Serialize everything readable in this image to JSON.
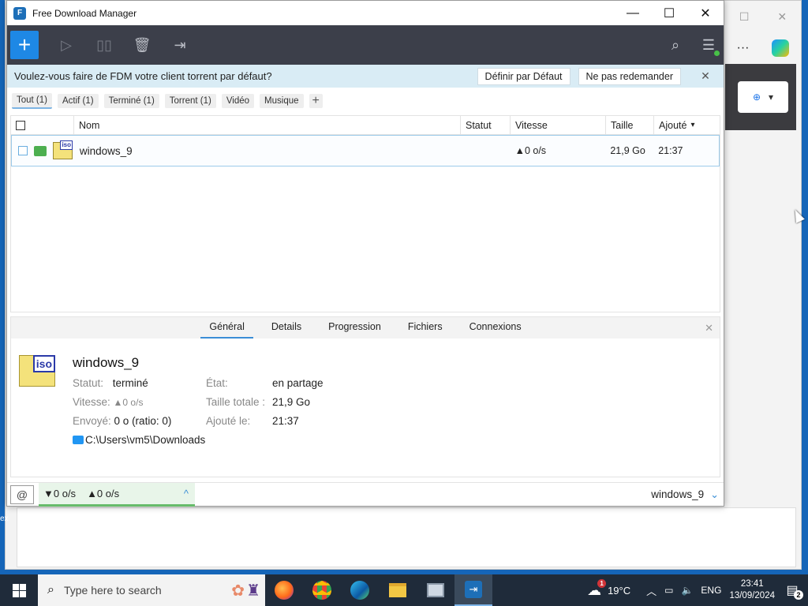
{
  "app": {
    "title": "Free Download Manager",
    "icon_glyph": "F"
  },
  "window_controls": {
    "minimize": "—",
    "maximize": "☐",
    "close": "✕"
  },
  "toolbar": {
    "add": "+",
    "icons": [
      "play-icon",
      "pause-icon",
      "delete-icon",
      "move-icon",
      "search-icon",
      "menu-icon"
    ],
    "accent": "#1e88e5"
  },
  "banner": {
    "text": "Voulez-vous faire de FDM votre client torrent par défaut?",
    "default_label": "Définir par Défaut",
    "dont_ask_label": "Ne pas redemander",
    "close": "✕"
  },
  "filters": [
    {
      "label": "Tout (1)",
      "active": true
    },
    {
      "label": "Actif (1)",
      "active": false
    },
    {
      "label": "Terminé (1)",
      "active": false
    },
    {
      "label": "Torrent (1)",
      "active": false
    },
    {
      "label": "Vidéo",
      "active": false
    },
    {
      "label": "Musique",
      "active": false
    }
  ],
  "filter_add": "+",
  "columns": {
    "name": "Nom",
    "status": "Statut",
    "speed": "Vitesse",
    "size": "Taille",
    "added": "Ajouté"
  },
  "downloads": [
    {
      "name": "windows_9",
      "status": "",
      "speed": "▲0 o/s",
      "size": "21,9 Go",
      "added": "21:37",
      "badge": "iso"
    }
  ],
  "details": {
    "tabs": [
      "Général",
      "Details",
      "Progression",
      "Fichiers",
      "Connexions"
    ],
    "active_tab": "Général",
    "close": "✕",
    "badge": "iso",
    "file_name": "windows_9",
    "status_label": "Statut:",
    "status_value": "terminé",
    "speed_label": "Vitesse:",
    "speed_value": "▲0 o/s",
    "sent_label": "Envoyé:",
    "sent_value": "0 o (ratio: 0)",
    "state_label": "État:",
    "state_value": "en partage",
    "total_size_label": "Taille totale :",
    "total_size_value": "21,9 Go",
    "added_label": "Ajouté le:",
    "added_value": "21:37",
    "path": "C:\\Users\\vm5\\Downloads"
  },
  "statusbar": {
    "download_speed": "▼0 o/s",
    "upload_speed": "▲0 o/s",
    "expand": "^",
    "current_file": "windows_9",
    "chevron": "⌄"
  },
  "background_browser": {
    "more": "···",
    "side_text": "ex"
  },
  "taskbar": {
    "search_placeholder": "Type here to search",
    "weather": "19°C",
    "weather_badge": "1",
    "language": "ENG",
    "time": "23:41",
    "date": "13/09/2024",
    "notification_count": "2"
  }
}
